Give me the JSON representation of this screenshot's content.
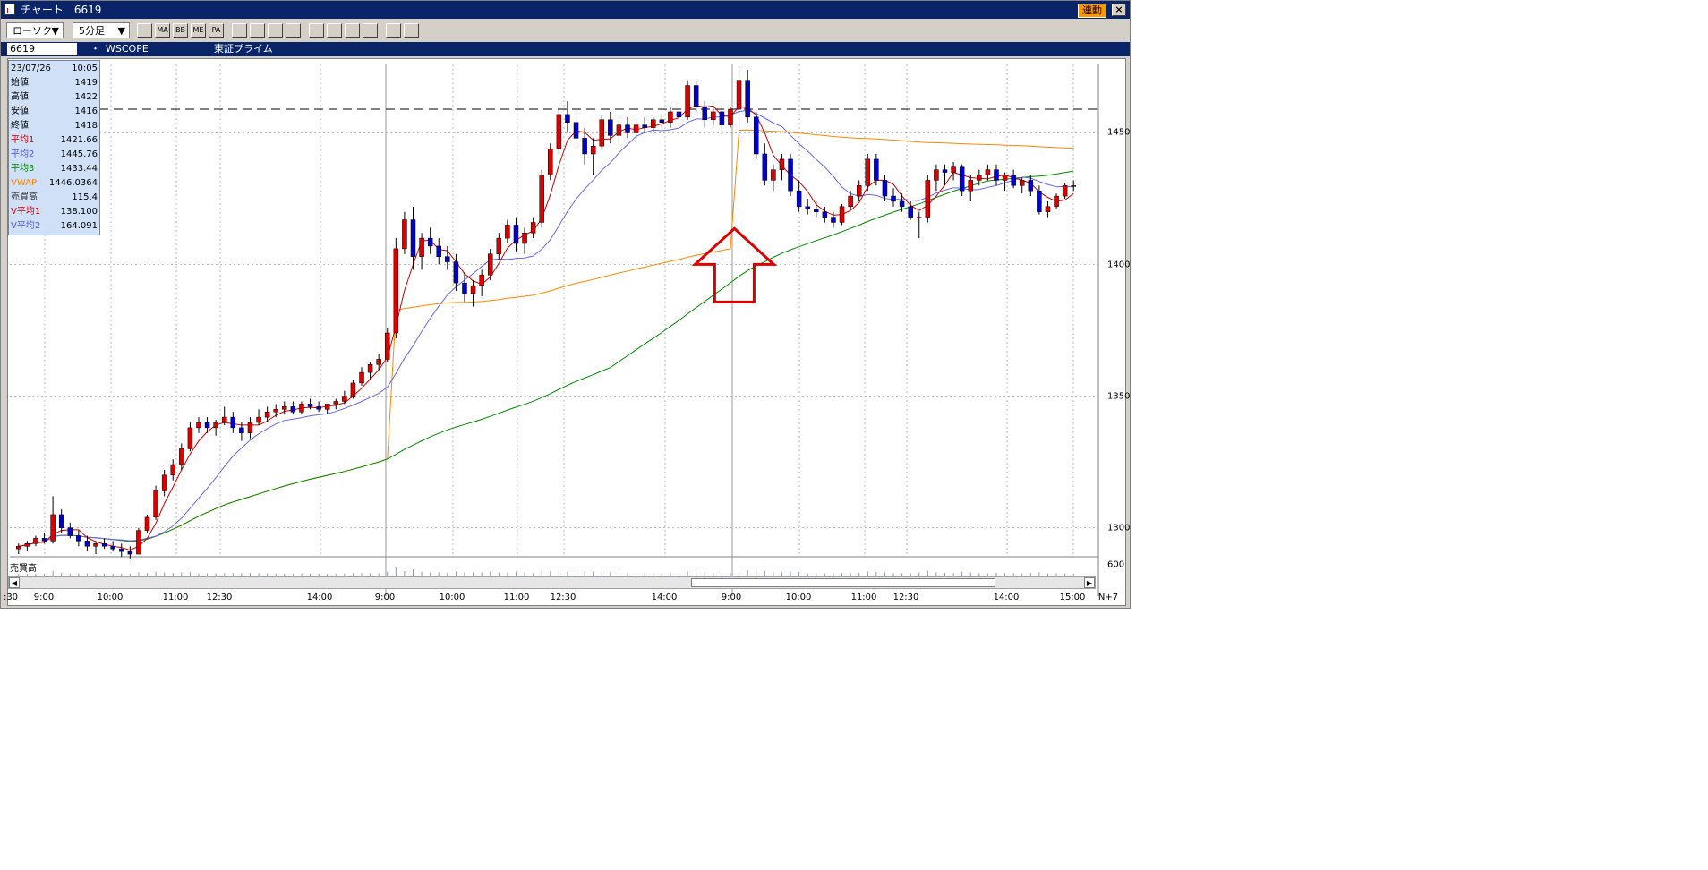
{
  "window": {
    "title": "チャート　6619",
    "sync_label": "連動",
    "close_glyph": "×"
  },
  "toolbar": {
    "chart_type": "ローソク",
    "interval": "5分足",
    "dropdown_glyph": "▼",
    "buttons": [
      {
        "icon": "bar-chart-icon",
        "label": ""
      },
      {
        "icon": "moving-average-icon",
        "label": "MA"
      },
      {
        "icon": "bollinger-icon",
        "label": "BB"
      },
      {
        "icon": "envelope-icon",
        "label": "ME"
      },
      {
        "icon": "parabolic-icon",
        "label": "PA"
      },
      {
        "icon": "line-indicator-icon",
        "label": ""
      },
      {
        "icon": "cross-indicator-icon",
        "label": ""
      },
      {
        "icon": "cursor-icon",
        "label": ""
      },
      {
        "icon": "magnifier-icon",
        "label": ""
      },
      {
        "icon": "pencil-icon",
        "label": ""
      },
      {
        "icon": "pointer-icon",
        "label": ""
      },
      {
        "icon": "eraser-icon",
        "label": ""
      },
      {
        "icon": "trash-icon",
        "label": ""
      },
      {
        "icon": "search-zoom-icon",
        "label": ""
      },
      {
        "icon": "fibonacci-icon",
        "label": ""
      }
    ]
  },
  "symbol": {
    "code": "6619",
    "dot": "・",
    "name": "WSCOPE",
    "market": "東証プライム"
  },
  "info_panel": {
    "datetime": {
      "date": "23/07/26",
      "time": "10:05"
    },
    "rows": [
      {
        "label": "始値",
        "value": "1419",
        "color": "#000000"
      },
      {
        "label": "高値",
        "value": "1422",
        "color": "#000000"
      },
      {
        "label": "安値",
        "value": "1416",
        "color": "#000000"
      },
      {
        "label": "終値",
        "value": "1418",
        "color": "#000000"
      },
      {
        "label": "平均1",
        "value": "1421.66",
        "color": "#cc0000"
      },
      {
        "label": "平均2",
        "value": "1445.76",
        "color": "#5555dd"
      },
      {
        "label": "平均3",
        "value": "1433.44",
        "color": "#008800"
      },
      {
        "label": "VWAP",
        "value": "1446.0364",
        "color": "#ff8800"
      },
      {
        "label": "売買高",
        "value": "115.4",
        "color": "#333333"
      },
      {
        "label": "V平均1",
        "value": "138.100",
        "color": "#cc0000"
      },
      {
        "label": "V平均2",
        "value": "164.091",
        "color": "#5555dd"
      }
    ]
  },
  "volume_pane": {
    "label": "売買高",
    "scale_label": "600"
  },
  "chart_data": {
    "type": "candlestick",
    "y_ticks": [
      "1450",
      "1400",
      "1350",
      "1300"
    ],
    "ylim": [
      1289,
      1476
    ],
    "resistance_line": 1459,
    "x_ticks": [
      ":30",
      "9:00",
      "10:00",
      "11:00",
      "12:30",
      "14:00",
      "9:00",
      "10:00",
      "11:00",
      "12:30",
      "14:00",
      "9:00",
      "10:00",
      "11:00",
      "12:30",
      "14:00",
      "15:00",
      "N+7"
    ],
    "day_separators": [
      6,
      11
    ],
    "colors": {
      "up": "#dd0000",
      "down": "#0000cc",
      "ma1": "#cc0000",
      "ma2": "#6666ee",
      "ma3": "#008800",
      "vwap": "#ff8800",
      "grid": "#bbbbbb",
      "arrow": "#dd0000"
    },
    "annotation": {
      "type": "up-arrow",
      "at_value": 1415
    },
    "candles": [
      [
        1292,
        1294,
        1290,
        1293
      ],
      [
        1293,
        1295,
        1291,
        1294
      ],
      [
        1294,
        1297,
        1293,
        1296
      ],
      [
        1296,
        1298,
        1294,
        1295
      ],
      [
        1295,
        1312,
        1294,
        1305
      ],
      [
        1305,
        1307,
        1298,
        1300
      ],
      [
        1300,
        1302,
        1296,
        1297
      ],
      [
        1297,
        1299,
        1293,
        1295
      ],
      [
        1295,
        1297,
        1291,
        1293
      ],
      [
        1293,
        1295,
        1290,
        1294
      ],
      [
        1294,
        1296,
        1292,
        1293
      ],
      [
        1293,
        1295,
        1291,
        1292
      ],
      [
        1292,
        1294,
        1289,
        1291
      ],
      [
        1291,
        1293,
        1288,
        1290
      ],
      [
        1290,
        1300,
        1290,
        1299
      ],
      [
        1299,
        1305,
        1298,
        1304
      ],
      [
        1304,
        1316,
        1303,
        1314
      ],
      [
        1314,
        1322,
        1312,
        1320
      ],
      [
        1320,
        1326,
        1318,
        1324
      ],
      [
        1324,
        1332,
        1322,
        1330
      ],
      [
        1330,
        1340,
        1329,
        1338
      ],
      [
        1338,
        1342,
        1336,
        1340
      ],
      [
        1340,
        1342,
        1336,
        1338
      ],
      [
        1338,
        1341,
        1335,
        1340
      ],
      [
        1340,
        1346,
        1339,
        1342
      ],
      [
        1342,
        1344,
        1336,
        1338
      ],
      [
        1338,
        1340,
        1333,
        1336
      ],
      [
        1336,
        1342,
        1334,
        1340
      ],
      [
        1340,
        1345,
        1339,
        1342
      ],
      [
        1342,
        1346,
        1340,
        1344
      ],
      [
        1344,
        1347,
        1342,
        1345
      ],
      [
        1345,
        1348,
        1343,
        1346
      ],
      [
        1346,
        1348,
        1343,
        1344
      ],
      [
        1344,
        1348,
        1343,
        1347
      ],
      [
        1347,
        1349,
        1345,
        1346
      ],
      [
        1346,
        1348,
        1344,
        1345
      ],
      [
        1345,
        1347,
        1343,
        1347
      ],
      [
        1347,
        1349,
        1345,
        1348
      ],
      [
        1348,
        1352,
        1347,
        1350
      ],
      [
        1350,
        1356,
        1349,
        1355
      ],
      [
        1355,
        1361,
        1354,
        1359
      ],
      [
        1359,
        1363,
        1356,
        1362
      ],
      [
        1362,
        1366,
        1360,
        1364
      ],
      [
        1364,
        1376,
        1363,
        1374
      ],
      [
        1374,
        1410,
        1372,
        1406
      ],
      [
        1406,
        1420,
        1404,
        1417
      ],
      [
        1417,
        1422,
        1398,
        1403
      ],
      [
        1403,
        1412,
        1398,
        1410
      ],
      [
        1410,
        1414,
        1404,
        1407
      ],
      [
        1407,
        1410,
        1400,
        1403
      ],
      [
        1403,
        1407,
        1398,
        1401
      ],
      [
        1401,
        1404,
        1390,
        1393
      ],
      [
        1393,
        1397,
        1386,
        1389
      ],
      [
        1389,
        1394,
        1384,
        1392
      ],
      [
        1392,
        1398,
        1388,
        1396
      ],
      [
        1396,
        1406,
        1394,
        1404
      ],
      [
        1404,
        1412,
        1402,
        1410
      ],
      [
        1410,
        1417,
        1408,
        1415
      ],
      [
        1415,
        1418,
        1405,
        1408
      ],
      [
        1408,
        1414,
        1404,
        1412
      ],
      [
        1412,
        1418,
        1410,
        1416
      ],
      [
        1416,
        1436,
        1414,
        1434
      ],
      [
        1434,
        1446,
        1432,
        1444
      ],
      [
        1444,
        1460,
        1442,
        1457
      ],
      [
        1457,
        1462,
        1450,
        1454
      ],
      [
        1454,
        1458,
        1445,
        1448
      ],
      [
        1448,
        1452,
        1438,
        1442
      ],
      [
        1442,
        1448,
        1434,
        1445
      ],
      [
        1445,
        1457,
        1444,
        1455
      ],
      [
        1455,
        1458,
        1446,
        1449
      ],
      [
        1449,
        1456,
        1446,
        1453
      ],
      [
        1453,
        1456,
        1448,
        1450
      ],
      [
        1450,
        1455,
        1448,
        1453
      ],
      [
        1453,
        1456,
        1450,
        1452
      ],
      [
        1452,
        1456,
        1450,
        1455
      ],
      [
        1455,
        1457,
        1452,
        1454
      ],
      [
        1454,
        1460,
        1452,
        1458
      ],
      [
        1458,
        1462,
        1454,
        1456
      ],
      [
        1456,
        1470,
        1455,
        1468
      ],
      [
        1468,
        1470,
        1458,
        1460
      ],
      [
        1460,
        1462,
        1452,
        1455
      ],
      [
        1455,
        1460,
        1453,
        1458
      ],
      [
        1458,
        1461,
        1451,
        1453
      ],
      [
        1453,
        1460,
        1452,
        1459
      ],
      [
        1459,
        1475,
        1448,
        1470
      ],
      [
        1470,
        1474,
        1454,
        1456
      ],
      [
        1456,
        1458,
        1440,
        1442
      ],
      [
        1442,
        1446,
        1430,
        1432
      ],
      [
        1432,
        1438,
        1428,
        1436
      ],
      [
        1436,
        1442,
        1432,
        1440
      ],
      [
        1440,
        1442,
        1426,
        1428
      ],
      [
        1428,
        1432,
        1420,
        1422
      ],
      [
        1422,
        1425,
        1419,
        1421
      ],
      [
        1421,
        1424,
        1418,
        1420
      ],
      [
        1420,
        1422,
        1416,
        1418
      ],
      [
        1418,
        1420,
        1414,
        1416
      ],
      [
        1416,
        1423,
        1415,
        1422
      ],
      [
        1422,
        1428,
        1421,
        1426
      ],
      [
        1426,
        1432,
        1424,
        1430
      ],
      [
        1430,
        1442,
        1428,
        1440
      ],
      [
        1440,
        1442,
        1430,
        1432
      ],
      [
        1432,
        1434,
        1424,
        1426
      ],
      [
        1426,
        1429,
        1422,
        1424
      ],
      [
        1424,
        1427,
        1420,
        1422
      ],
      [
        1422,
        1424,
        1417,
        1418
      ],
      [
        1418,
        1420,
        1410,
        1418
      ],
      [
        1418,
        1434,
        1416,
        1432
      ],
      [
        1432,
        1438,
        1428,
        1436
      ],
      [
        1436,
        1438,
        1430,
        1435
      ],
      [
        1435,
        1439,
        1432,
        1437
      ],
      [
        1437,
        1438,
        1426,
        1428
      ],
      [
        1428,
        1434,
        1424,
        1432
      ],
      [
        1432,
        1436,
        1430,
        1434
      ],
      [
        1434,
        1438,
        1432,
        1436
      ],
      [
        1436,
        1438,
        1430,
        1432
      ],
      [
        1432,
        1435,
        1428,
        1434
      ],
      [
        1434,
        1436,
        1429,
        1430
      ],
      [
        1430,
        1433,
        1427,
        1432
      ],
      [
        1432,
        1434,
        1426,
        1428
      ],
      [
        1428,
        1430,
        1419,
        1420
      ],
      [
        1420,
        1424,
        1418,
        1422
      ],
      [
        1422,
        1427,
        1421,
        1426
      ],
      [
        1426,
        1431,
        1425,
        1430
      ],
      [
        1430,
        1432,
        1428,
        1430
      ]
    ]
  }
}
